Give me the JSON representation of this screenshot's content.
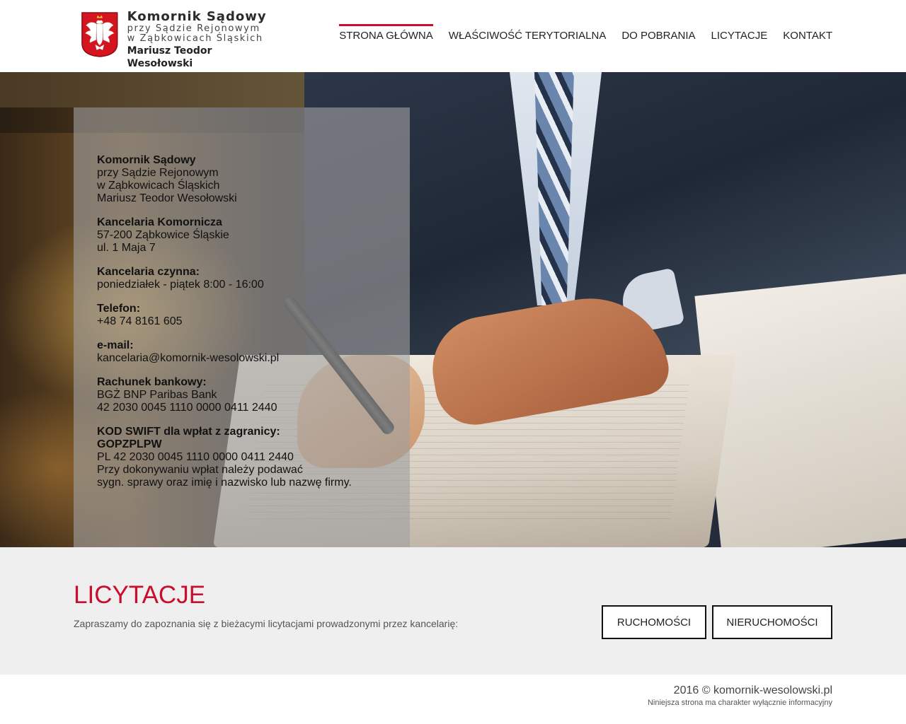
{
  "logo": {
    "line1": "Komornik Sądowy",
    "line2": "przy Sądzie Rejonowym",
    "line3": "w Ząbkowicach Śląskich",
    "line4": "Mariusz Teodor Wesołowski"
  },
  "nav": {
    "items": [
      {
        "label": "STRONA GŁÓWNA",
        "active": true
      },
      {
        "label": "WŁAŚCIWOŚĆ TERYTORIALNA",
        "active": false
      },
      {
        "label": "DO POBRANIA",
        "active": false
      },
      {
        "label": "LICYTACJE",
        "active": false
      },
      {
        "label": "KONTAKT",
        "active": false
      }
    ]
  },
  "info": {
    "office_name": {
      "title": "Komornik Sądowy",
      "line1": "przy Sądzie Rejonowym",
      "line2": "w Ząbkowicach Śląskich",
      "line3": "Mariusz Teodor Wesołowski"
    },
    "address": {
      "title": "Kancelaria Komornicza",
      "line1": "57-200 Ząbkowice Śląskie",
      "line2": "ul. 1 Maja 7"
    },
    "hours": {
      "title": "Kancelaria czynna:",
      "line1": "poniedziałek - piątek 8:00 - 16:00"
    },
    "phone": {
      "title": "Telefon:",
      "line1": "+48 74 8161 605"
    },
    "email": {
      "title": "e-mail:",
      "line1": "kancelaria@komornik-wesolowski.pl"
    },
    "bank": {
      "title": "Rachunek bankowy:",
      "line1": "BGŻ BNP Paribas Bank",
      "line2": "42 2030 0045 1110 0000 0411 2440"
    },
    "swift": {
      "title": "KOD SWIFT dla wpłat z zagranicy:",
      "code": "GOPZPLPW",
      "line1": "PL 42 2030 0045 1110 0000 0411 2440",
      "line2": "Przy dokonywaniu wpłat należy podawać",
      "line3": "sygn. sprawy oraz imię i nazwisko lub nazwę firmy."
    }
  },
  "auctions": {
    "title": "LICYTACJE",
    "text": "Zapraszamy do zapoznania się z bieżacymi licytacjami prowadzonymi przez kancelarię:",
    "btn_movable": "RUCHOMOŚCI",
    "btn_immovable": "NIERUCHOMOŚCI"
  },
  "footer": {
    "copy": "2016 © komornik-wesolowski.pl",
    "note": "Niniejsza strona ma charakter wyłącznie informacyjny"
  },
  "colors": {
    "accent": "#c8102e",
    "section_bg": "#efefef"
  },
  "icons": {
    "emblem": "polish-eagle-emblem"
  }
}
